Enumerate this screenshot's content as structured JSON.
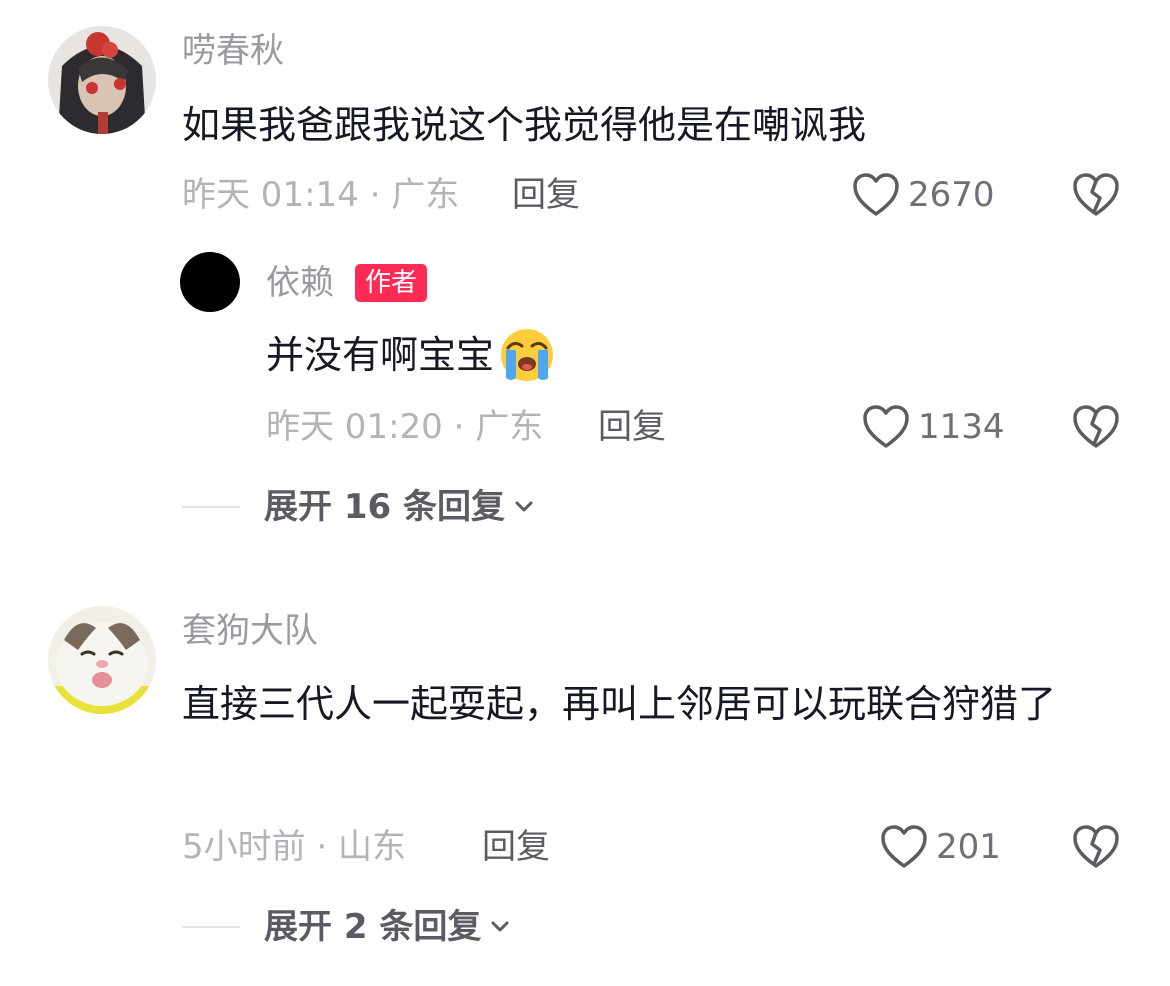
{
  "comments": [
    {
      "username": "唠春秋",
      "content": "如果我爸跟我说这个我觉得他是在嘲讽我",
      "meta": "昨天 01:14 · 广东",
      "reply_label": "回复",
      "likes": "2670",
      "avatar_icon": "costume-girl-avatar",
      "replies": [
        {
          "username": "依赖",
          "badge": "作者",
          "content": "并没有啊宝宝",
          "emoji": "loudly-crying-face-emoji",
          "meta": "昨天 01:20 · 广东",
          "reply_label": "回复",
          "likes": "1134"
        }
      ],
      "expand_label": "展开 16 条回复"
    },
    {
      "username": "套狗大队",
      "content": "直接三代人一起耍起，再叫上邻居可以玩联合狩猎了",
      "meta": "5小时前 · 山东",
      "reply_label": "回复",
      "likes": "201",
      "avatar_icon": "cat-avatar",
      "expand_label": "展开 2 条回复"
    }
  ],
  "icons": {
    "like": "heart-outline-icon",
    "dislike": "broken-heart-icon",
    "expand": "chevron-down-icon"
  },
  "colors": {
    "author_badge": "#fe2c55",
    "username": "#9a9ba2",
    "meta": "#b3b4b9",
    "text": "#161823"
  }
}
